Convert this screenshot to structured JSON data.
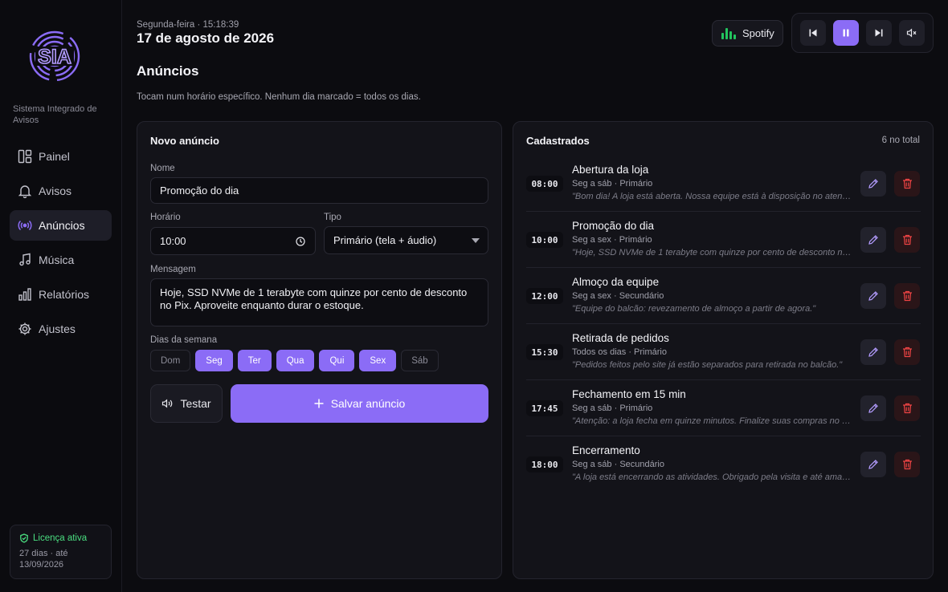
{
  "app": {
    "tagline": "Sistema Integrado de Avisos"
  },
  "sidebar": {
    "items": [
      {
        "label": "Painel",
        "icon": "layout-icon"
      },
      {
        "label": "Avisos",
        "icon": "bell-icon"
      },
      {
        "label": "Anúncios",
        "icon": "broadcast-icon",
        "active": true
      },
      {
        "label": "Música",
        "icon": "music-icon"
      },
      {
        "label": "Relatórios",
        "icon": "bar-chart-icon"
      },
      {
        "label": "Ajustes",
        "icon": "gear-icon"
      }
    ],
    "license": {
      "title": "Licença ativa",
      "detail": "27 dias · até 13/09/2026"
    }
  },
  "header": {
    "date_small": "Segunda-feira · 15:18:39",
    "date_big": "17 de agosto de 2026",
    "page_title": "Anúncios",
    "page_subtitle": "Tocam num horário específico. Nenhum dia marcado = todos os dias.",
    "spotify_label": "Spotify"
  },
  "colors": {
    "accent": "#8b6cf6",
    "spotify": "#22c55e",
    "license": "#4ade80",
    "danger": "#ef4444"
  },
  "form": {
    "title": "Novo anúncio",
    "name_label": "Nome",
    "name_value": "Promoção do dia",
    "time_label": "Horário",
    "time_value": "10:00",
    "type_label": "Tipo",
    "type_value": "Primário (tela + áudio)",
    "message_label": "Mensagem",
    "message_value": "Hoje, SSD NVMe de 1 terabyte com quinze por cento de desconto no Pix. Aproveite enquanto durar o estoque.",
    "days_label": "Dias da semana",
    "days": [
      {
        "label": "Dom",
        "on": false
      },
      {
        "label": "Seg",
        "on": true
      },
      {
        "label": "Ter",
        "on": true
      },
      {
        "label": "Qua",
        "on": true
      },
      {
        "label": "Qui",
        "on": true
      },
      {
        "label": "Sex",
        "on": true
      },
      {
        "label": "Sáb",
        "on": false
      }
    ],
    "test_label": "Testar",
    "save_label": "Salvar anúncio"
  },
  "list": {
    "title": "Cadastrados",
    "count": "6 no total",
    "items": [
      {
        "time": "08:00",
        "title": "Abertura da loja",
        "meta": "Seg a sáb · Primário",
        "message": "\"Bom dia! A loja está aberta. Nossa equipe está à disposição no atendimento.\""
      },
      {
        "time": "10:00",
        "title": "Promoção do dia",
        "meta": "Seg a sex · Primário",
        "message": "\"Hoje, SSD NVMe de 1 terabyte com quinze por cento de desconto no Pix.\""
      },
      {
        "time": "12:00",
        "title": "Almoço da equipe",
        "meta": "Seg a sex · Secundário",
        "message": "\"Equipe do balcão: revezamento de almoço a partir de agora.\""
      },
      {
        "time": "15:30",
        "title": "Retirada de pedidos",
        "meta": "Todos os dias · Primário",
        "message": "\"Pedidos feitos pelo site já estão separados para retirada no balcão.\""
      },
      {
        "time": "17:45",
        "title": "Fechamento em 15 min",
        "meta": "Seg a sáb · Primário",
        "message": "\"Atenção: a loja fecha em quinze minutos. Finalize suas compras no caixa.\""
      },
      {
        "time": "18:00",
        "title": "Encerramento",
        "meta": "Seg a sáb · Secundário",
        "message": "\"A loja está encerrando as atividades. Obrigado pela visita e até amanhã.\""
      }
    ]
  }
}
